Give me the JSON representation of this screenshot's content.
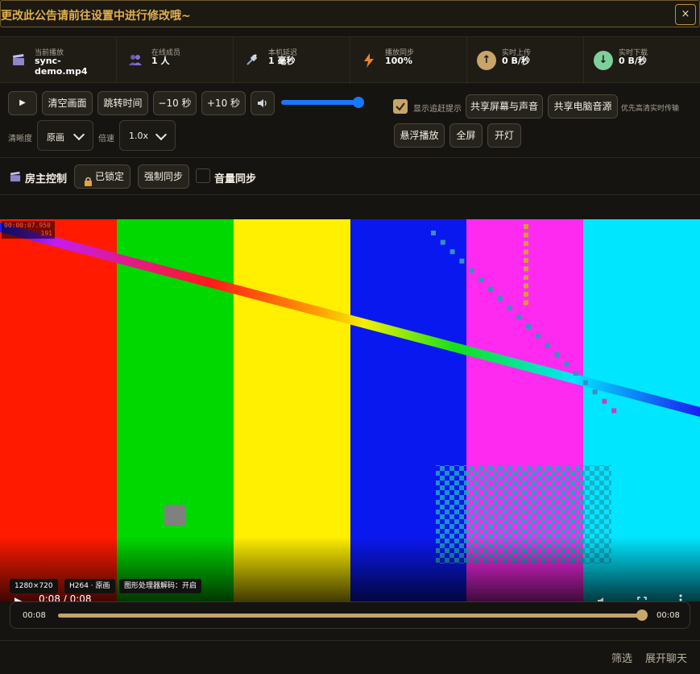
{
  "announcement": {
    "text": "更改此公告请前往设置中进行修改哦~",
    "close_label": "×"
  },
  "stats": [
    {
      "label": "当前播放",
      "value": "sync-\ndemo.mp4",
      "icon": "clapperboard-icon"
    },
    {
      "label": "在线成员",
      "value": "1 人",
      "icon": "users-icon"
    },
    {
      "label": "本机延迟",
      "value": "1 毫秒",
      "icon": "satellite-icon"
    },
    {
      "label": "播放同步",
      "value": "100%",
      "icon": "lightning-icon"
    },
    {
      "label": "实时上传",
      "value": "0 B/秒",
      "icon": "upload-arrow-icon"
    },
    {
      "label": "实时下载",
      "value": "0 B/秒",
      "icon": "download-arrow-icon"
    }
  ],
  "controls": {
    "play_label": "▶",
    "clear_label": "清空画面",
    "seek_label": "跳转时间",
    "back10_label": "−10 秒",
    "fwd10_label": "+10 秒",
    "volume_level": 1.0,
    "show_catchup_label": "显示追赶提示",
    "show_catchup_checked": true,
    "share_screen_label": "共享屏幕与声音",
    "share_audio_label": "共享电脑音源",
    "hd_hint": "优先高清实时传输",
    "float_label": "悬浮播放",
    "fullscreen_label": "全屏",
    "light_label": "开灯",
    "quality_label": "清晰度",
    "quality_value": "原画",
    "speed_label": "倍速",
    "speed_value": "1.0x"
  },
  "host": {
    "title": "房主控制",
    "locked_label": "已锁定",
    "force_sync_label": "强制同步",
    "volume_sync_label": "音量同步",
    "volume_sync_checked": false
  },
  "video": {
    "timecode": "00:00:07.950",
    "frame": "191",
    "chips": [
      "1280×720",
      "H264 · 原画",
      "图形处理器解码：开启"
    ],
    "time_text": "0:08 / 0:08",
    "bar_colors": [
      "#ff1a00",
      "#00d800",
      "#ffef00",
      "#0a18f0",
      "#ff2af0",
      "#00e6ff"
    ]
  },
  "progress": {
    "current": "00:08",
    "total": "00:08",
    "fraction": 1.0
  },
  "footer": {
    "filter_label": "筛选",
    "chat_label": "展开聊天"
  },
  "colors": {
    "accent": "#c3a56b",
    "announce_text": "#e2b04a",
    "slider_blue": "#1677ff"
  }
}
